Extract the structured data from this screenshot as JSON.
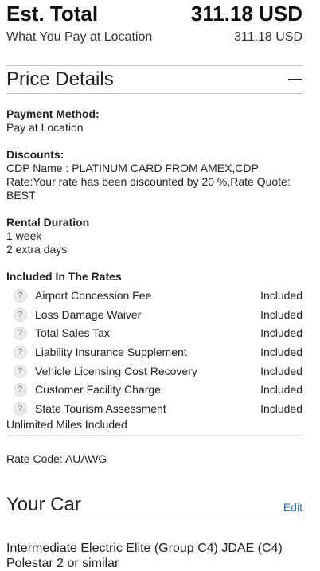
{
  "total": {
    "label": "Est. Total",
    "value": "311.18 USD"
  },
  "pay_location": {
    "label": "What You Pay at Location",
    "value": "311.18 USD"
  },
  "price_details": {
    "title": "Price Details",
    "payment_method": {
      "label": "Payment Method:",
      "value": "Pay at Location"
    },
    "discounts": {
      "label": "Discounts:",
      "value": "CDP Name : PLATINUM CARD FROM AMEX,CDP Rate:Your rate has been discounted by 20 %,Rate Quote: BEST"
    },
    "rental_duration": {
      "label": "Rental Duration",
      "lines": [
        "1 week",
        "2 extra days"
      ]
    },
    "included": {
      "label": "Included In The Rates",
      "items": [
        {
          "name": "Airport Concession Fee",
          "value": "Included"
        },
        {
          "name": "Loss Damage Waiver",
          "value": "Included"
        },
        {
          "name": "Total Sales Tax",
          "value": "Included"
        },
        {
          "name": "Liability Insurance Supplement",
          "value": "Included"
        },
        {
          "name": "Vehicle Licensing Cost Recovery",
          "value": "Included"
        },
        {
          "name": "Customer Facility Charge",
          "value": "Included"
        },
        {
          "name": "State Tourism Assessment",
          "value": "Included"
        }
      ],
      "icon": "question-icon",
      "icon_glyph": "?"
    },
    "unlimited_miles": "Unlimited Miles Included",
    "rate_code": "Rate Code: AUAWG",
    "collapse_icon": "minus-icon"
  },
  "your_car": {
    "title": "Your Car",
    "edit_label": "Edit",
    "car_name": "Intermediate Electric Elite (Group C4) JDAE (C4) Polestar 2 or similar"
  },
  "colors": {
    "link": "#2f6fb6",
    "divider": "#bdbdbd"
  }
}
